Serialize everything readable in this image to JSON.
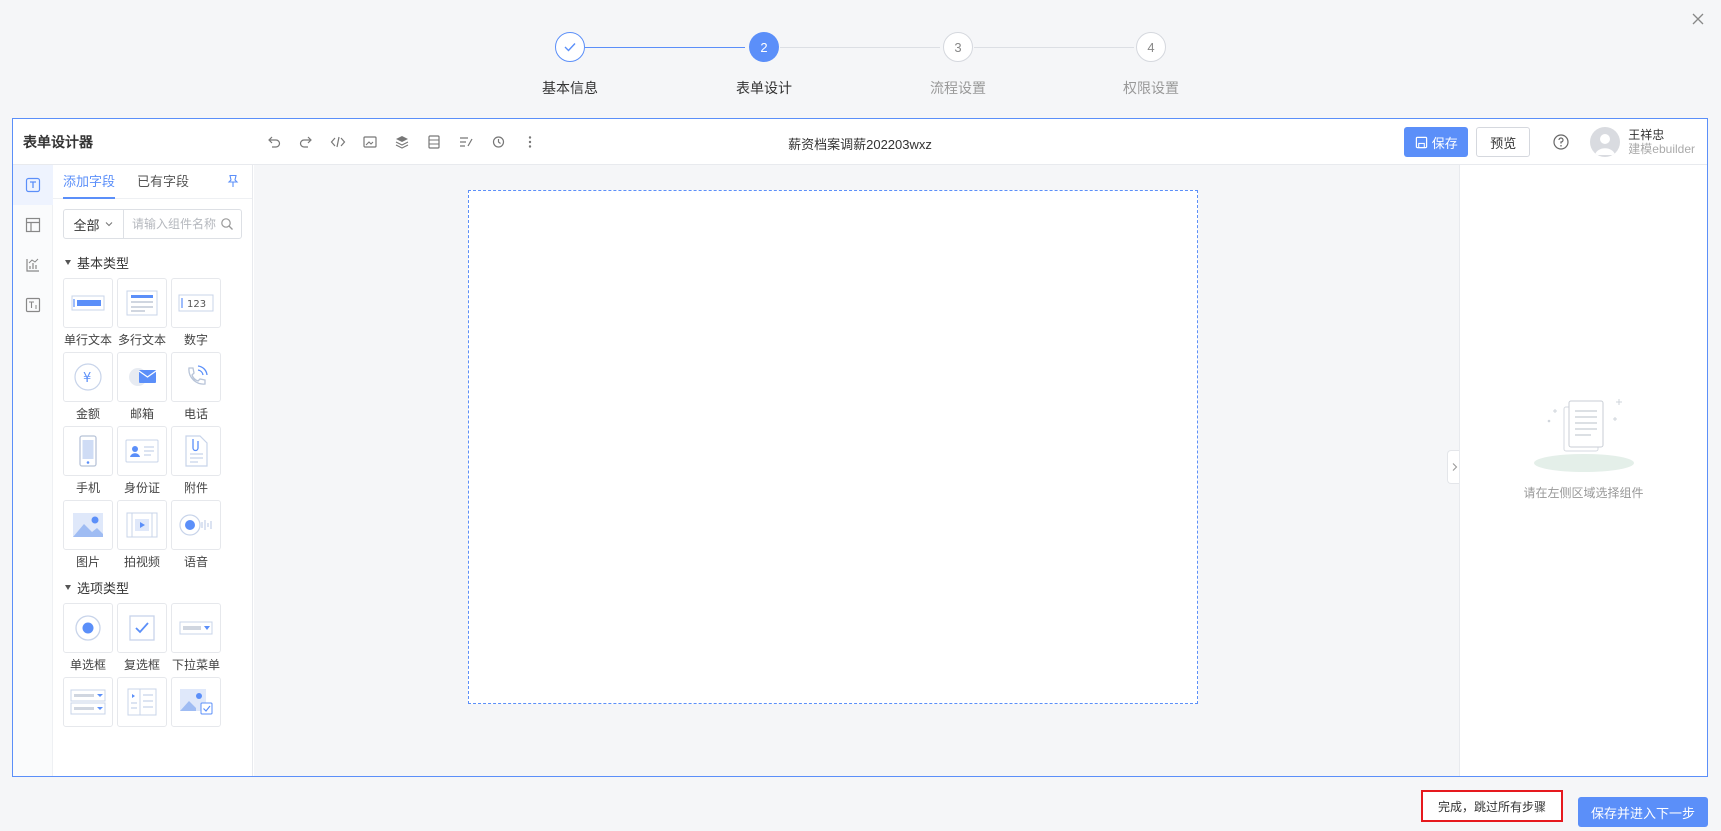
{
  "stepper": {
    "steps": [
      {
        "num": "✓",
        "label": "基本信息",
        "state": "done"
      },
      {
        "num": "2",
        "label": "表单设计",
        "state": "active"
      },
      {
        "num": "3",
        "label": "流程设置",
        "state": "todo"
      },
      {
        "num": "4",
        "label": "权限设置",
        "state": "todo"
      }
    ]
  },
  "designer": {
    "title": "表单设计器",
    "doc_name": "薪资档案调薪202203wxz",
    "save_label": "保存",
    "preview_label": "预览",
    "user": {
      "name": "王祥忠",
      "role": "建模ebuilder"
    }
  },
  "field_panel": {
    "tabs": [
      "添加字段",
      "已有字段"
    ],
    "filter_value": "全部",
    "search_placeholder": "请输入组件名称",
    "groups": [
      {
        "title": "基本类型",
        "items": [
          "单行文本",
          "多行文本",
          "数字",
          "金额",
          "邮箱",
          "电话",
          "手机",
          "身份证",
          "附件",
          "图片",
          "拍视频",
          "语音"
        ]
      },
      {
        "title": "选项类型",
        "items": [
          "单选框",
          "复选框",
          "下拉菜单",
          "",
          "",
          ""
        ]
      }
    ]
  },
  "prop_panel": {
    "empty_text": "请在左侧区域选择组件"
  },
  "footer": {
    "skip_label": "完成，跳过所有步骤",
    "next_label": "保存并进入下一步"
  },
  "colors": {
    "accent": "#5b8ff9",
    "highlight": "#e6191e"
  }
}
